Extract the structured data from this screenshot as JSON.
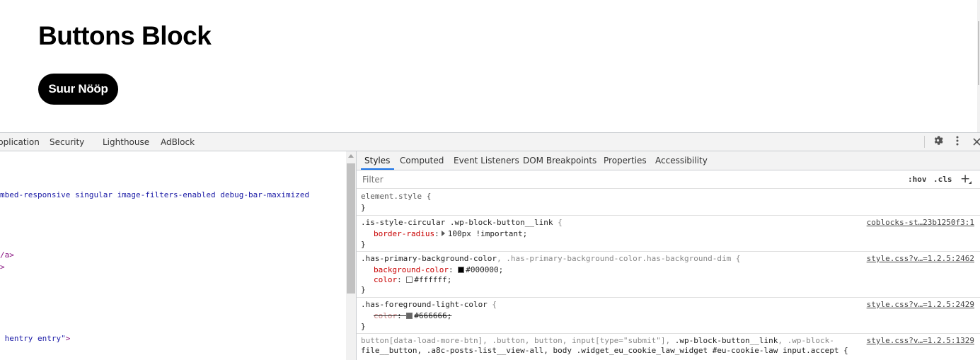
{
  "page": {
    "heading": "Buttons Block",
    "button_label": "Suur Nööp"
  },
  "devtools": {
    "top_tabs": [
      "pplication",
      "Security",
      "Lighthouse",
      "AdBlock"
    ],
    "icons": [
      "gear-icon",
      "more-vertical-icon",
      "close-icon"
    ],
    "elements_lines": [
      {
        "text": "mbed-responsive singular image-filters-enabled debug-bar-maximized",
        "kind": "attr"
      },
      {
        "text": "/a>",
        "kind": "tag"
      },
      {
        "text": ">",
        "kind": "tag"
      },
      {
        "text": " hentry entry\"",
        "kind": "attr"
      },
      {
        "text": ">",
        "kind": "tag"
      }
    ],
    "styles_tabs": [
      "Styles",
      "Computed",
      "Event Listeners",
      "DOM Breakpoints",
      "Properties",
      "Accessibility"
    ],
    "filter_placeholder": "Filter",
    "hov_label": ":hov",
    "cls_label": ".cls",
    "plus_label": "+",
    "rules": {
      "element_style": {
        "selector": "element.style {",
        "close": "}"
      },
      "circular": {
        "selector_match": ".is-style-circular .wp-block-button__link",
        "open": " {",
        "source": "coblocks-st…23b1250f3:1",
        "prop": "border-radius",
        "value": "100px !important;",
        "close": "}"
      },
      "primary_bg": {
        "selector_match": ".has-primary-background-color",
        "selector_dim": ", .has-primary-background-color.has-background-dim",
        "open": " {",
        "source": "style.css?v…=1.2.5:2462",
        "decl1_prop": "background-color",
        "decl1_value": "#000000;",
        "decl1_swatch": "#000000",
        "decl2_prop": "color",
        "decl2_value": "#ffffff;",
        "decl2_swatch": "#ffffff",
        "close": "}"
      },
      "fg_light": {
        "selector_match": ".has-foreground-light-color",
        "open": " {",
        "source": "style.css?v…=1.2.5:2429",
        "prop": "color",
        "value": "#666666;",
        "swatch": "#666666",
        "close": "}"
      },
      "button_rule": {
        "line1a": "button[data-load-more-btn], .button, button, input[type=\"submit\"], ",
        "line1b": ".wp-block-button__link",
        "line1c": ", .wp-block-",
        "line2": "file__button, .a8c-posts-list__view-all, body .widget_eu_cookie_law_widget #eu-cookie-law input.accept {",
        "source": "style.css?v…=1.2.5:1329"
      }
    }
  }
}
